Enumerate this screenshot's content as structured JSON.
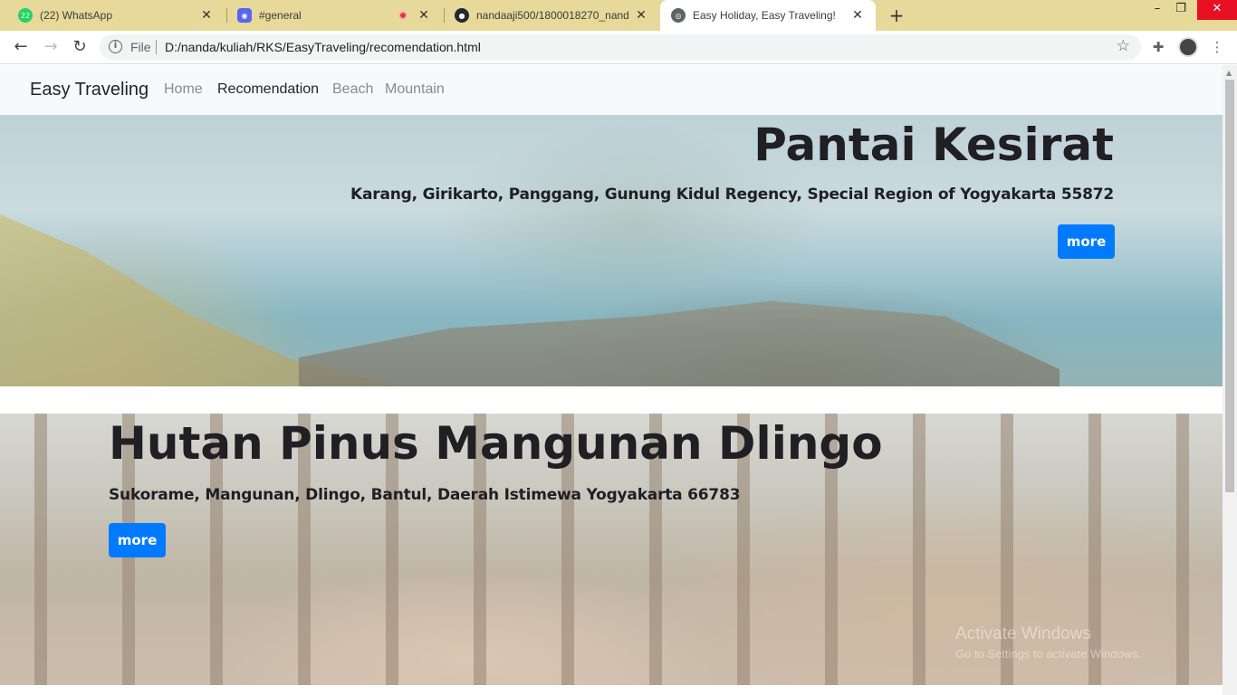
{
  "browser": {
    "tabs": [
      {
        "title": "(22) WhatsApp",
        "badge": "22",
        "icon": "whatsapp-icon",
        "color": "#25d366"
      },
      {
        "title": "#general",
        "icon": "discord-icon",
        "color": "#5865f2"
      },
      {
        "title": "nandaaji500/1800018270_nanda",
        "icon": "github-icon",
        "color": "#24292e"
      },
      {
        "title": "Easy Holiday, Easy Traveling!",
        "icon": "globe-icon",
        "color": "#5f6368"
      }
    ],
    "address": {
      "scheme_label": "File",
      "url": "D:/nanda/kuliah/RKS/EasyTraveling/recomendation.html"
    }
  },
  "site": {
    "brand": "Easy Traveling",
    "nav": [
      {
        "label": "Home"
      },
      {
        "label": "Recomendation",
        "active": true
      },
      {
        "label": "Beach"
      },
      {
        "label": "Mountain"
      }
    ],
    "destinations": [
      {
        "title": "Pantai Kesirat",
        "address": "Karang, Girikarto, Panggang, Gunung Kidul Regency, Special Region of Yogyakarta 55872",
        "button": "more"
      },
      {
        "title": "Hutan Pinus Mangunan Dlingo",
        "address": "Sukorame, Mangunan, Dlingo, Bantul, Daerah Istimewa Yogyakarta 66783",
        "button": "more"
      }
    ]
  },
  "watermark": {
    "line1": "Activate Windows",
    "line2": "Go to Settings to activate Windows."
  },
  "colors": {
    "tabstrip": "#e6d99a",
    "primary_button": "#007bff",
    "navbar": "#f8f9fa"
  }
}
